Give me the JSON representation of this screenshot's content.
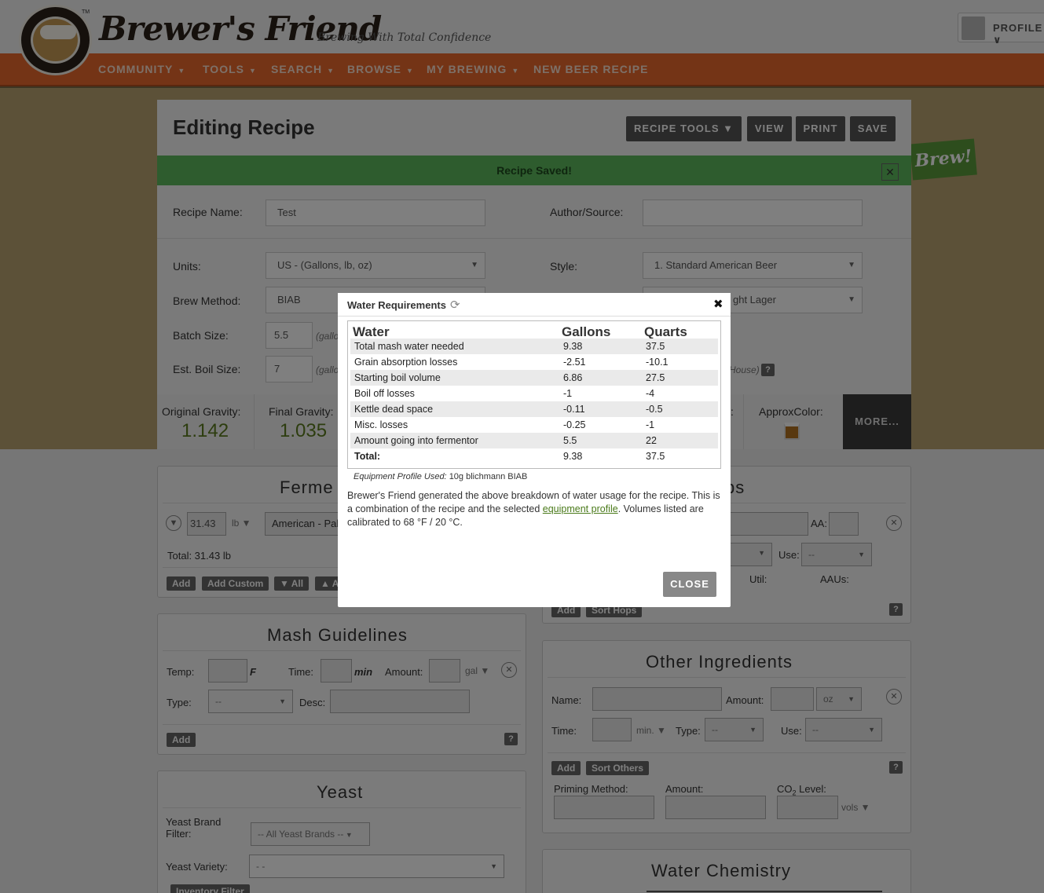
{
  "header": {
    "brand": "Brewer's Friend",
    "tm": "TM",
    "tagline": "Brewing With Total Confidence",
    "profile_label": "PROFILE",
    "nav": [
      {
        "label": "COMMUNITY",
        "has_caret": true
      },
      {
        "label": "TOOLS",
        "has_caret": true
      },
      {
        "label": "SEARCH",
        "has_caret": true
      },
      {
        "label": "BROWSE",
        "has_caret": true
      },
      {
        "label": "MY BREWING",
        "has_caret": true
      },
      {
        "label": "NEW BEER RECIPE",
        "has_caret": false
      }
    ]
  },
  "editor": {
    "title": "Editing Recipe",
    "toolbar": {
      "recipe_tools": "RECIPE TOOLS ▼",
      "view": "VIEW",
      "print": "PRINT",
      "save": "SAVE"
    },
    "saved_message": "Recipe Saved!",
    "saved_close": "✕",
    "brew_badge": "Brew!",
    "fields": {
      "recipe_name_label": "Recipe Name:",
      "recipe_name_value": "Test",
      "author_label": "Author/Source:",
      "author_value": "",
      "units_label": "Units:",
      "units_value": "US - (Gallons, lb, oz)",
      "style_label": "Style:",
      "style_value": "1. Standard American Beer",
      "brew_method_label": "Brew Method:",
      "brew_method_value": "BIAB",
      "substyle_value": "ght Lager",
      "batch_size_label": "Batch Size:",
      "batch_size_value": "5.5",
      "batch_unit": "(gallo",
      "boil_size_label": "Est. Boil Size:",
      "boil_size_value": "7",
      "boil_unit": "(gallo",
      "house_fragment": "House)"
    },
    "stats": {
      "og_label": "Original Gravity:",
      "og_value": "1.142",
      "fg_label": "Final Gravity:",
      "fg_value": "1.035",
      "color_label": "ApproxColor:",
      "colon_fragment": ":",
      "more": "MORE..."
    }
  },
  "fermentables": {
    "title": "Ferme",
    "amount": "31.43",
    "unit": "lb",
    "grain": "American - Pale",
    "total": "Total: 31.43 lb",
    "buttons": [
      "Add",
      "Add Custom",
      "▼ All",
      "▲ A"
    ]
  },
  "hops": {
    "title_fragment": "ps",
    "aa_label": "AA:",
    "use_label": "Use:",
    "use_value": "--",
    "util_label": "Util:",
    "aaus_label": "AAUs:",
    "buttons": [
      "Add",
      "Sort Hops"
    ],
    "help": "?"
  },
  "mash": {
    "title": "Mash Guidelines",
    "temp_label": "Temp:",
    "temp_unit": "F",
    "time_label": "Time:",
    "time_unit": "min",
    "amount_label": "Amount:",
    "amount_unit": "gal",
    "type_label": "Type:",
    "type_value": "--",
    "desc_label": "Desc:",
    "add": "Add",
    "help": "?"
  },
  "other": {
    "title": "Other Ingredients",
    "name_label": "Name:",
    "amount_label": "Amount:",
    "amount_unit": "oz",
    "time_label": "Time:",
    "time_unit": "min.",
    "type_label": "Type:",
    "type_value": "--",
    "use_label": "Use:",
    "use_value": "--",
    "add": "Add",
    "sort": "Sort Others",
    "help": "?",
    "priming_label": "Priming Method:",
    "priming_amount_label": "Amount:",
    "co2_label": "CO",
    "co2_sub": "2",
    "co2_label_rest": " Level:",
    "co2_unit": "vols"
  },
  "yeast": {
    "title": "Yeast",
    "brand_filter_label_1": "Yeast Brand",
    "brand_filter_label_2": "Filter:",
    "brand_filter_value": "-- All Yeast Brands --",
    "variety_label": "Yeast Variety:",
    "variety_value": "- -",
    "inventory_filter": "Inventory Filter"
  },
  "water_chem": {
    "title": "Water Chemistry"
  },
  "modal": {
    "title": "Water Requirements",
    "close_x": "✖",
    "headers": [
      "Water",
      "Gallons",
      "Quarts"
    ],
    "rows": [
      {
        "label": "Total mash water needed",
        "gallons": "9.38",
        "quarts": "37.5"
      },
      {
        "label": "Grain absorption losses",
        "gallons": "-2.51",
        "quarts": "-10.1"
      },
      {
        "label": "Starting boil volume",
        "gallons": "6.86",
        "quarts": "27.5"
      },
      {
        "label": "Boil off losses",
        "gallons": "-1",
        "quarts": "-4"
      },
      {
        "label": "Kettle dead space",
        "gallons": "-0.11",
        "quarts": "-0.5"
      },
      {
        "label": "Misc. losses",
        "gallons": "-0.25",
        "quarts": "-1"
      },
      {
        "label": "Amount going into fermentor",
        "gallons": "5.5",
        "quarts": "22"
      },
      {
        "label": "Total:",
        "gallons": "9.38",
        "quarts": "37.5"
      }
    ],
    "equipment_label": "Equipment Profile Used:",
    "equipment_value": "10g blichmann BIAB",
    "desc_before": "Brewer's Friend generated the above breakdown of water usage for the recipe. This is a combination of the recipe and the selected ",
    "desc_link": "equipment profile",
    "desc_after": ". Volumes listed are calibrated to 68 °F / 20 °C.",
    "close_button": "CLOSE"
  }
}
